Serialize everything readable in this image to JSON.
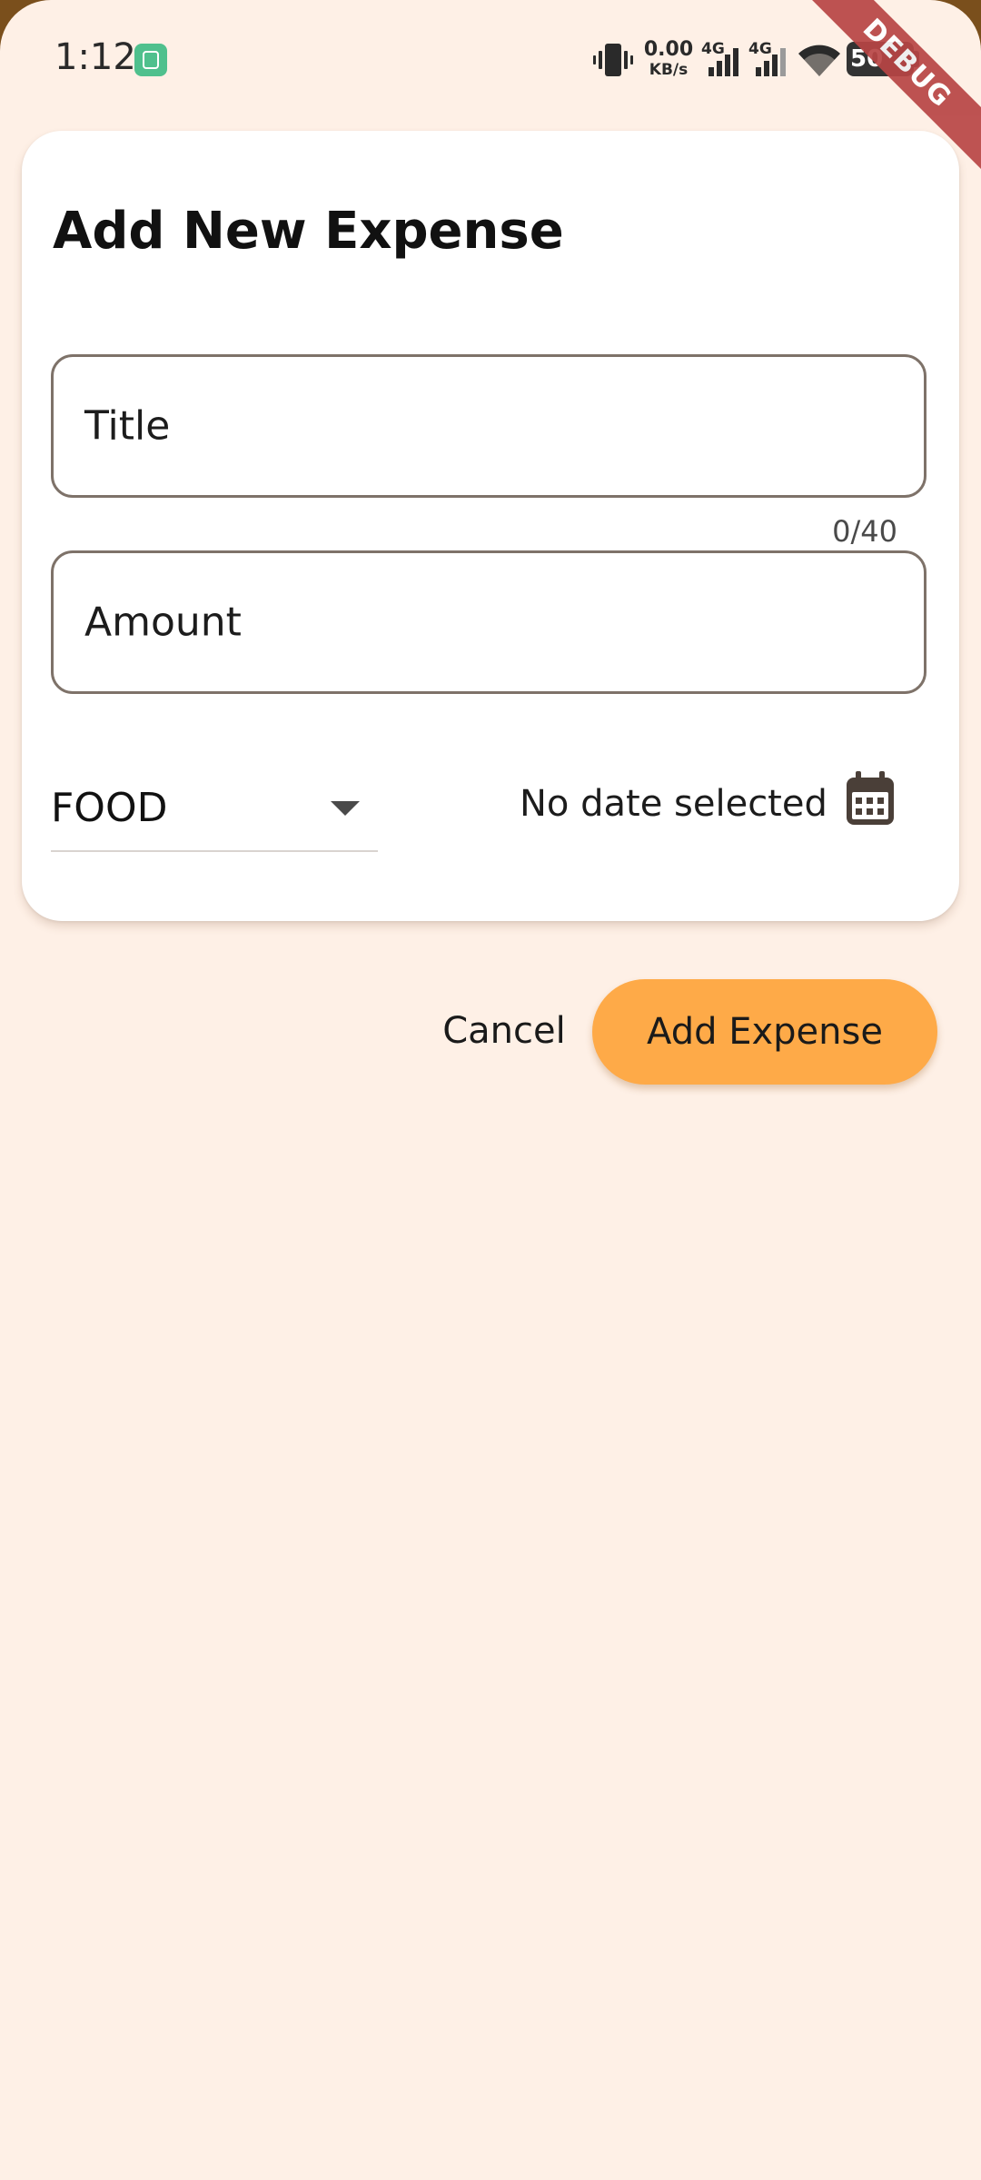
{
  "status_bar": {
    "time": "1:12",
    "net_speed_value": "0.00",
    "net_speed_unit": "KB/s",
    "signal1_label": "4G",
    "signal2_label": "4G",
    "battery_level": "50",
    "app_icon": "app-notification-icon",
    "vibrate_icon": "vibrate-icon",
    "wifi_icon": "wifi-icon"
  },
  "debug_banner": "DEBUG",
  "form": {
    "title": "Add New Expense",
    "title_field": {
      "placeholder": "Title",
      "value": "",
      "counter": "0/40"
    },
    "amount_field": {
      "placeholder": "Amount",
      "value": ""
    },
    "category": {
      "selected": "FOOD",
      "icon": "dropdown-arrow-icon"
    },
    "date": {
      "label": "No date selected",
      "icon": "calendar-icon"
    }
  },
  "actions": {
    "cancel_label": "Cancel",
    "submit_label": "Add Expense"
  },
  "colors": {
    "background": "#FEF0E6",
    "card": "#FFFFFF",
    "field_border": "#7E7269",
    "primary_button": "#FEAA48",
    "debug_banner": "#B84545",
    "calendar_icon": "#4A3F38"
  }
}
